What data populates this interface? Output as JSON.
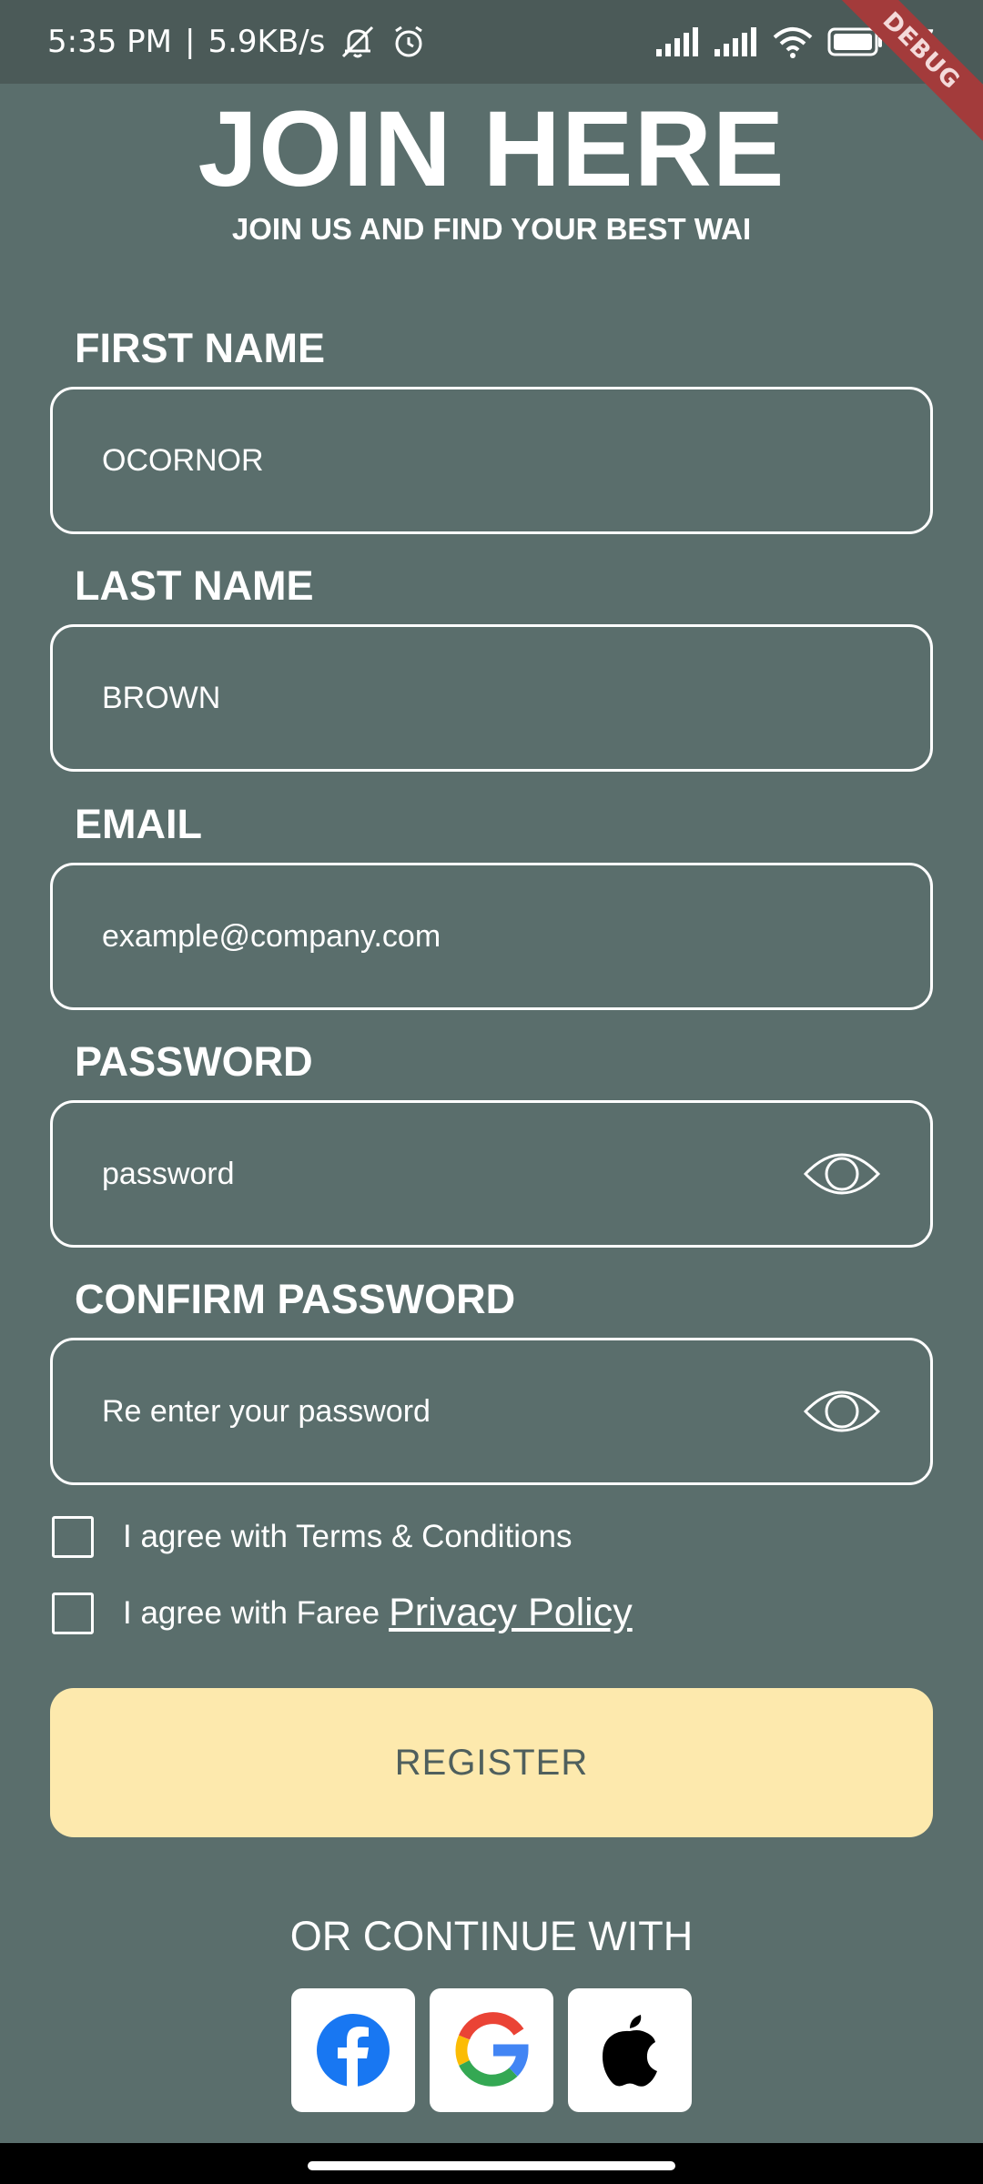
{
  "status_bar": {
    "time": "5:35 PM",
    "separator": "|",
    "net_speed": "5.9KB/s",
    "battery": "97",
    "icons": [
      "bell-off-icon",
      "alarm-icon",
      "signal-icon",
      "signal-icon",
      "wifi-icon",
      "battery-icon"
    ]
  },
  "debug_banner": "DEBUG",
  "header": {
    "title": "JOIN HERE",
    "subtitle": "JOIN US AND FIND YOUR BEST WAI"
  },
  "form": {
    "first_name": {
      "label": "FIRST NAME",
      "value": "OCORNOR"
    },
    "last_name": {
      "label": "LAST NAME",
      "value": "BROWN"
    },
    "email": {
      "label": "EMAIL",
      "placeholder": "example@company.com"
    },
    "password": {
      "label": "PASSWORD",
      "placeholder": "password"
    },
    "confirm_password": {
      "label": "CONFIRM PASSWORD",
      "placeholder": "Re enter your password"
    }
  },
  "agreements": {
    "terms": {
      "text": "I agree with Terms & Conditions",
      "checked": false
    },
    "privacy": {
      "text": "I agree with Faree",
      "link": "Privacy Policy",
      "checked": false
    }
  },
  "register_label": "REGISTER",
  "continue_label": "OR CONTINUE WITH",
  "social": [
    "facebook-icon",
    "google-icon",
    "apple-icon"
  ],
  "colors": {
    "background": "#5a6e6c",
    "status_bar": "#4b5a58",
    "register_button": "#fde9ad",
    "register_text": "#4f5f5d",
    "facebook_blue": "#1877f2"
  }
}
